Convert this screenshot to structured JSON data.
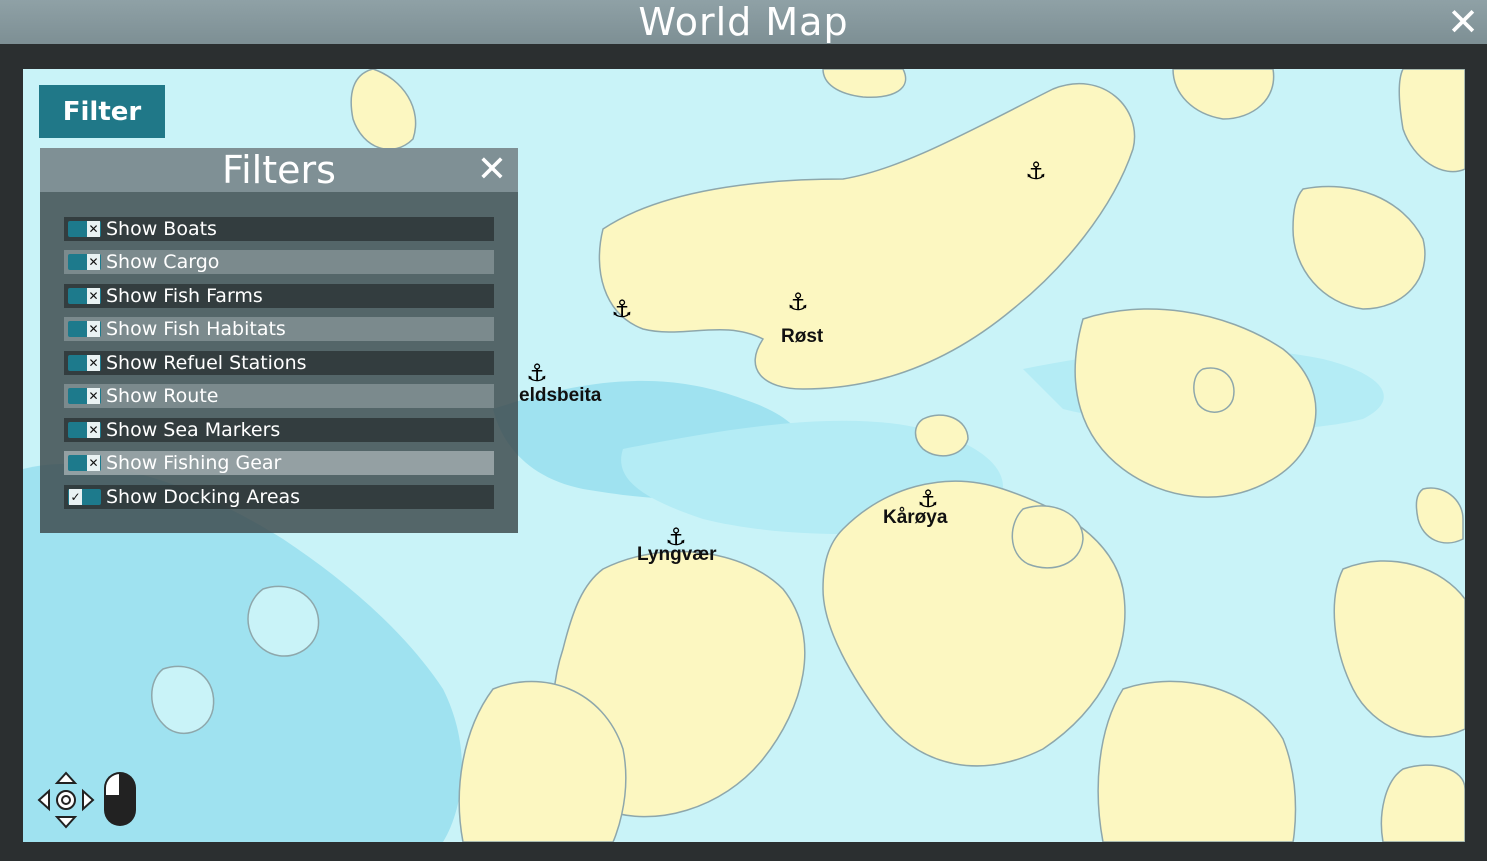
{
  "window": {
    "title": "World Map",
    "close_icon": "close-icon"
  },
  "filter_button": {
    "label": "Filter"
  },
  "filters_panel": {
    "title": "Filters",
    "close_icon": "close-icon",
    "items": [
      {
        "label": "Show Boats",
        "checked": false
      },
      {
        "label": "Show Cargo",
        "checked": false
      },
      {
        "label": "Show Fish Farms",
        "checked": false
      },
      {
        "label": "Show Fish Habitats",
        "checked": false
      },
      {
        "label": "Show Refuel Stations",
        "checked": false
      },
      {
        "label": "Show Route",
        "checked": false
      },
      {
        "label": "Show Sea Markers",
        "checked": false
      },
      {
        "label": "Show Fishing Gear",
        "checked": false
      },
      {
        "label": "Show Docking Areas",
        "checked": true
      }
    ]
  },
  "map": {
    "colors": {
      "water": "#c9f3f8",
      "shallow": "#a9e9f3",
      "deep": "#8fdcee",
      "land": "#fcf7c1"
    },
    "places": [
      "eldsbeita",
      "Røst",
      "Lyngvær",
      "Kårøya"
    ],
    "anchor_icon": "anchor-icon"
  },
  "controls": {
    "navigation_icon": "pan-arrows-icon",
    "mouse_icon": "mouse-icon"
  }
}
